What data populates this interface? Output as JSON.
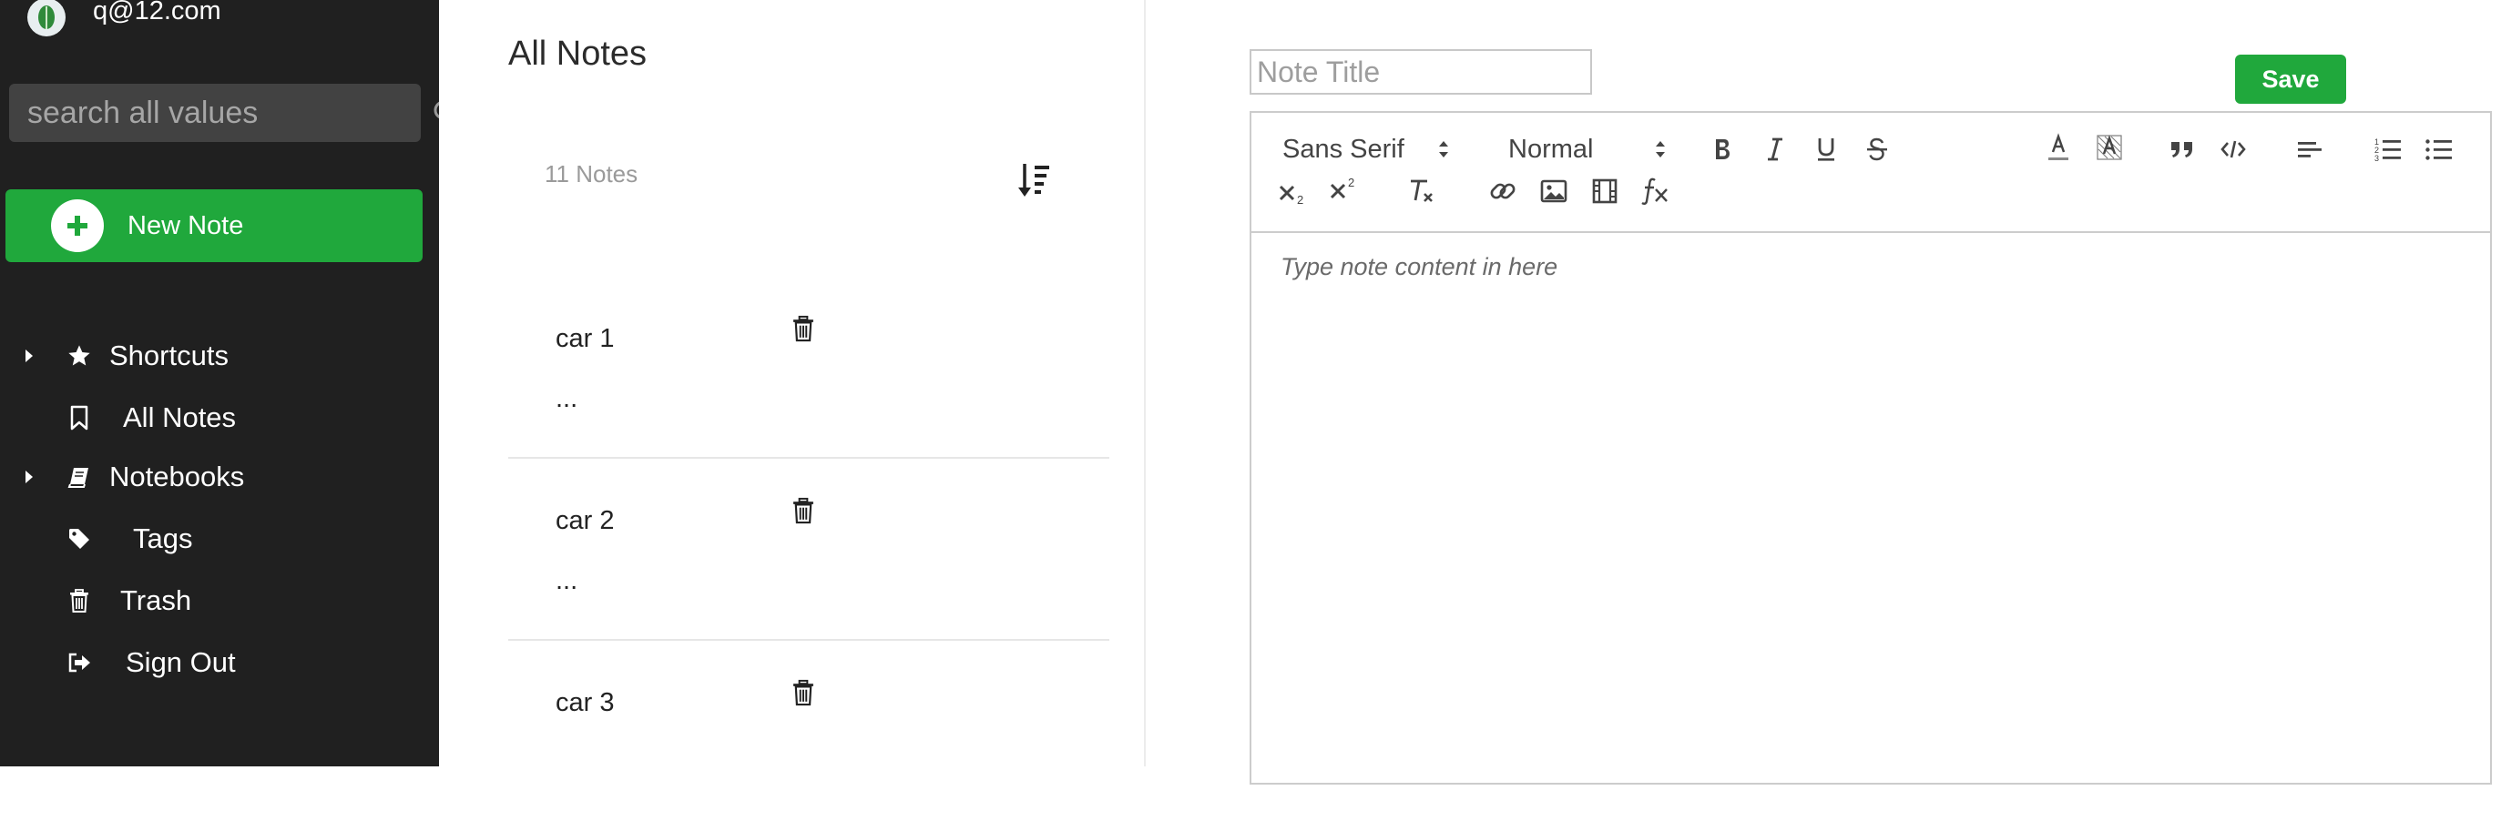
{
  "user": {
    "email": "q@12.com"
  },
  "search": {
    "placeholder": "search all values"
  },
  "new_note": {
    "label": "New Note"
  },
  "nav": [
    {
      "label": "Shortcuts",
      "icon": "star-icon"
    },
    {
      "label": "All Notes",
      "icon": "bookmark-icon"
    },
    {
      "label": "Notebooks",
      "icon": "book-icon"
    },
    {
      "label": "Tags",
      "icon": "tag-icon"
    },
    {
      "label": "Trash",
      "icon": "trash-icon"
    },
    {
      "label": "Sign Out",
      "icon": "sign-out-icon"
    }
  ],
  "notes": {
    "title": "All Notes",
    "count_label": "11 Notes",
    "items": [
      {
        "title": "car 1",
        "snippet": "..."
      },
      {
        "title": "car 2",
        "snippet": "..."
      },
      {
        "title": "car 3",
        "snippet": ""
      }
    ]
  },
  "editor": {
    "title_placeholder": "Note Title",
    "save_label": "Save",
    "font_value": "Sans Serif",
    "size_value": "Normal",
    "content_placeholder": "Type note content in here"
  },
  "colors": {
    "sidebar_bg": "#202020",
    "accent_green": "#20a83c"
  }
}
